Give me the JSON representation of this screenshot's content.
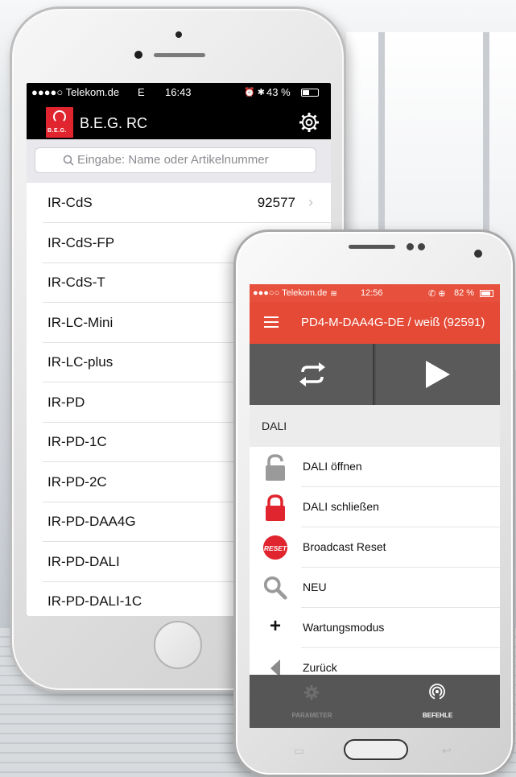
{
  "iphone": {
    "status": {
      "carrier": "●●●●○ Telekom.de",
      "network": "E",
      "time": "16:43",
      "battery": "43 %"
    },
    "header": {
      "logo_text": "B.E.G.",
      "title": "B.E.G. RC"
    },
    "search": {
      "placeholder": "Eingabe: Name oder Artikelnummer"
    },
    "rows": [
      {
        "label": "IR-CdS",
        "number": "92577",
        "chevron": "›"
      },
      {
        "label": "IR-CdS-FP"
      },
      {
        "label": "IR-CdS-T"
      },
      {
        "label": "IR-LC-Mini"
      },
      {
        "label": "IR-LC-plus"
      },
      {
        "label": "IR-PD"
      },
      {
        "label": "IR-PD-1C"
      },
      {
        "label": "IR-PD-2C"
      },
      {
        "label": "IR-PD-DAA4G"
      },
      {
        "label": "IR-PD-DALI"
      },
      {
        "label": "IR-PD-DALI-1C"
      }
    ]
  },
  "android": {
    "status": {
      "carrier": "●●●○○ Telekom.de",
      "time": "12:56",
      "battery": "82 %"
    },
    "appbar": {
      "title": "PD4-M-DAA4G-DE / weiß  (92591)"
    },
    "section": "DALI",
    "items": [
      {
        "label": "DALI öffnen",
        "icon": "lock-open-icon"
      },
      {
        "label": "DALI schließen",
        "icon": "lock-closed-icon"
      },
      {
        "label": "Broadcast Reset",
        "icon": "reset-icon",
        "icon_text": "RESET"
      },
      {
        "label": "NEU",
        "icon": "magnifier-icon"
      },
      {
        "label": "Wartungsmodus",
        "icon": "plus-icon",
        "icon_text": "+"
      },
      {
        "label": "Zurück",
        "icon": "back-arrow-icon"
      }
    ],
    "tabs": [
      {
        "label": "PARAMETER",
        "icon": "gear-icon",
        "active": false
      },
      {
        "label": "BEFEHLE",
        "icon": "signal-icon",
        "active": true
      }
    ],
    "colors": {
      "accent": "#e44a36",
      "lock_red": "#e0252e",
      "dark_panel": "#565656"
    }
  }
}
